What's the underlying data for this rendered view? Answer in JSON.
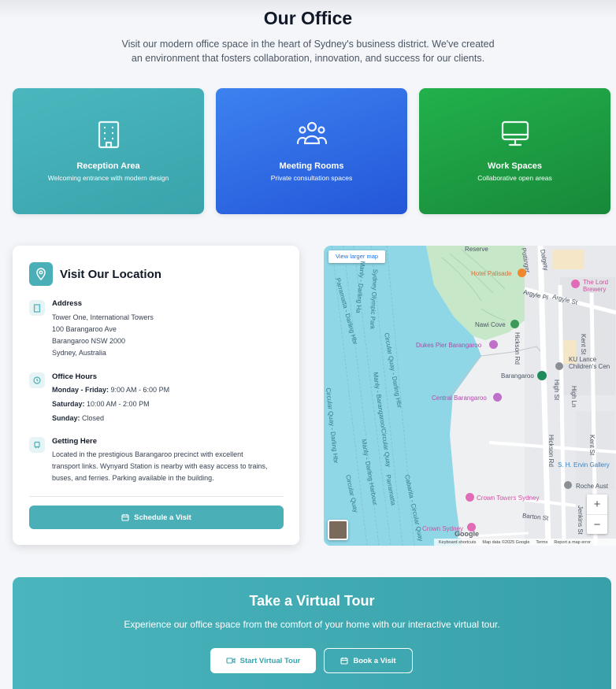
{
  "header": {
    "title": "Our Office",
    "intro": "Visit our modern office space in the heart of Sydney's business district. We've created an environment that fosters collaboration, innovation, and success for our clients."
  },
  "features": [
    {
      "icon": "building-icon",
      "title": "Reception Area",
      "subtitle": "Welcoming entrance with modern design",
      "color": "#4ab7be"
    },
    {
      "icon": "users-icon",
      "title": "Meeting Rooms",
      "subtitle": "Private consultation spaces",
      "color": "#2f6de6"
    },
    {
      "icon": "monitor-icon",
      "title": "Work Spaces",
      "subtitle": "Collaborative open areas",
      "color": "#1f9e45"
    }
  ],
  "location": {
    "title": "Visit Our Location",
    "address": {
      "label": "Address",
      "lines": [
        "Tower One, International Towers",
        "100 Barangaroo Ave",
        "Barangaroo NSW 2000",
        "Sydney, Australia"
      ]
    },
    "hours": {
      "label": "Office Hours",
      "rows": [
        {
          "day": "Monday - Friday:",
          "time": "9:00 AM - 6:00 PM"
        },
        {
          "day": "Saturday:",
          "time": "10:00 AM - 2:00 PM"
        },
        {
          "day": "Sunday:",
          "time": "Closed"
        }
      ]
    },
    "getting_here": {
      "label": "Getting Here",
      "text": "Located in the prestigious Barangaroo precinct with excellent transport links. Wynyard Station is nearby with easy access to trains, buses, and ferries. Parking available in the building."
    },
    "schedule_button": "Schedule a Visit"
  },
  "map": {
    "view_larger": "View larger map",
    "labels": {
      "reserve": "Reserve",
      "hotel_palisade": "Hotel Palisade",
      "the_lord": "The Lord",
      "brewery": "Brewery",
      "argyle_pl": "Argyle Pl",
      "argyle_st": "Argyle St",
      "nawi_cove": "Nawi Cove",
      "dukes_pier": "Dukes Pier Barangaroo",
      "barangaroo": "Barangaroo",
      "ku_lance": "KU Lance",
      "children_cen": "Children's Cen",
      "central_barangaroo": "Central Barangaroo",
      "sh_ervin": "S. H. Ervin Gallery",
      "roche": "Roche Aust",
      "crown_towers": "Crown Towers Sydney",
      "crown_sydney": "Crown Sydney",
      "hickson_rd": "Hickson Rd",
      "kent_st": "Kent St",
      "high_st": "High St",
      "high_ln": "High Ln",
      "barton_st": "Barton St",
      "jenkins_st": "Jenkins St",
      "water1": "Manly - Darling Ha",
      "water2": "Sydney Olympic Park",
      "water3": "Parramatta - Darling Hbr",
      "water4": "Circular Quay - Darling Hbr",
      "water5": "Manly - Barangaroo/Circular Quay",
      "water6": "Circular Quay - Darling Hbr",
      "water7": "Manly - Darling Harbour",
      "water8": "Circular Quay",
      "water9": "Cabarita - Circular Quay",
      "water10": "Parramatta",
      "dalgety": "Dalgety",
      "pottinger": "Pottinger"
    },
    "attribution": [
      "Keyboard shortcuts",
      "Map data ©2025 Google",
      "Terms",
      "Report a map error"
    ],
    "google": "Google",
    "zoom_in": "+",
    "zoom_out": "−"
  },
  "tour": {
    "title": "Take a Virtual Tour",
    "subtitle": "Experience our office space from the comfort of your home with our interactive virtual tour.",
    "start_button": "Start Virtual Tour",
    "book_button": "Book a Visit"
  }
}
